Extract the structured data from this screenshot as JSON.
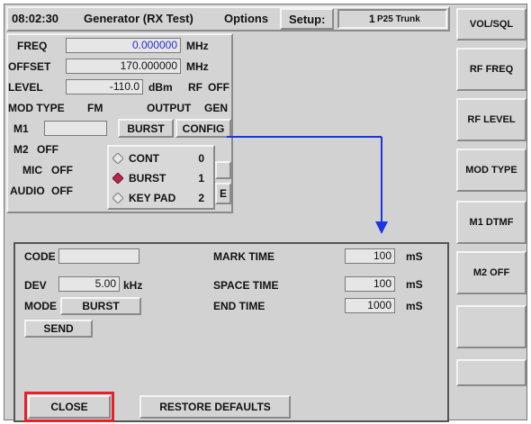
{
  "header": {
    "time": "08:02:30",
    "title": "Generator (RX Test)",
    "options_label": "Options",
    "setup_label": "Setup:",
    "setup_value": "1",
    "setup_mode": "P25 Trunk"
  },
  "generator": {
    "freq_label": "FREQ",
    "freq_value": "0.000000",
    "freq_unit": "MHz",
    "offset_label": "OFFSET",
    "offset_value": "170.000000",
    "offset_unit": "MHz",
    "level_label": "LEVEL",
    "level_value": "-110.0",
    "level_unit": "dBm",
    "rf_label": "RF",
    "rf_state": "OFF",
    "modtype_label": "MOD TYPE",
    "modtype_value": "FM",
    "output_label": "OUTPUT",
    "output_value": "GEN",
    "m1_label": "M1",
    "m1_mode": "BURST",
    "m1_config": "CONFIG",
    "m2_label": "M2",
    "m2_state": "OFF",
    "mic_label": "MIC",
    "mic_state": "OFF",
    "audio_label": "AUDIO",
    "audio_state": "OFF",
    "hidden_fragment": "E"
  },
  "popup_menu": {
    "items": [
      {
        "label": "CONT",
        "key": "0",
        "selected": false
      },
      {
        "label": "BURST",
        "key": "1",
        "selected": true
      },
      {
        "label": "KEY PAD",
        "key": "2",
        "selected": false
      }
    ]
  },
  "softkeys": [
    {
      "label": "VOL/SQL"
    },
    {
      "label": "RF FREQ"
    },
    {
      "label": "RF LEVEL"
    },
    {
      "label": "MOD TYPE"
    },
    {
      "label": "M1 DTMF"
    },
    {
      "label": "M2 OFF"
    },
    {
      "label": ""
    },
    {
      "label": ""
    }
  ],
  "config_panel": {
    "code_label": "CODE",
    "code_value": "",
    "dev_label": "DEV",
    "dev_value": "5.00",
    "dev_unit": "kHz",
    "mode_label": "MODE",
    "mode_value": "BURST",
    "send_label": "SEND",
    "mark_label": "MARK TIME",
    "mark_value": "100",
    "mark_unit": "mS",
    "space_label": "SPACE TIME",
    "space_value": "100",
    "space_unit": "mS",
    "end_label": "END TIME",
    "end_value": "1000",
    "end_unit": "mS",
    "close_label": "CLOSE",
    "restore_label": "RESTORE DEFAULTS"
  },
  "colors": {
    "annotation_blue": "#1a35e6",
    "highlight_red": "#e8202a",
    "selected_radio": "#b8284a"
  }
}
